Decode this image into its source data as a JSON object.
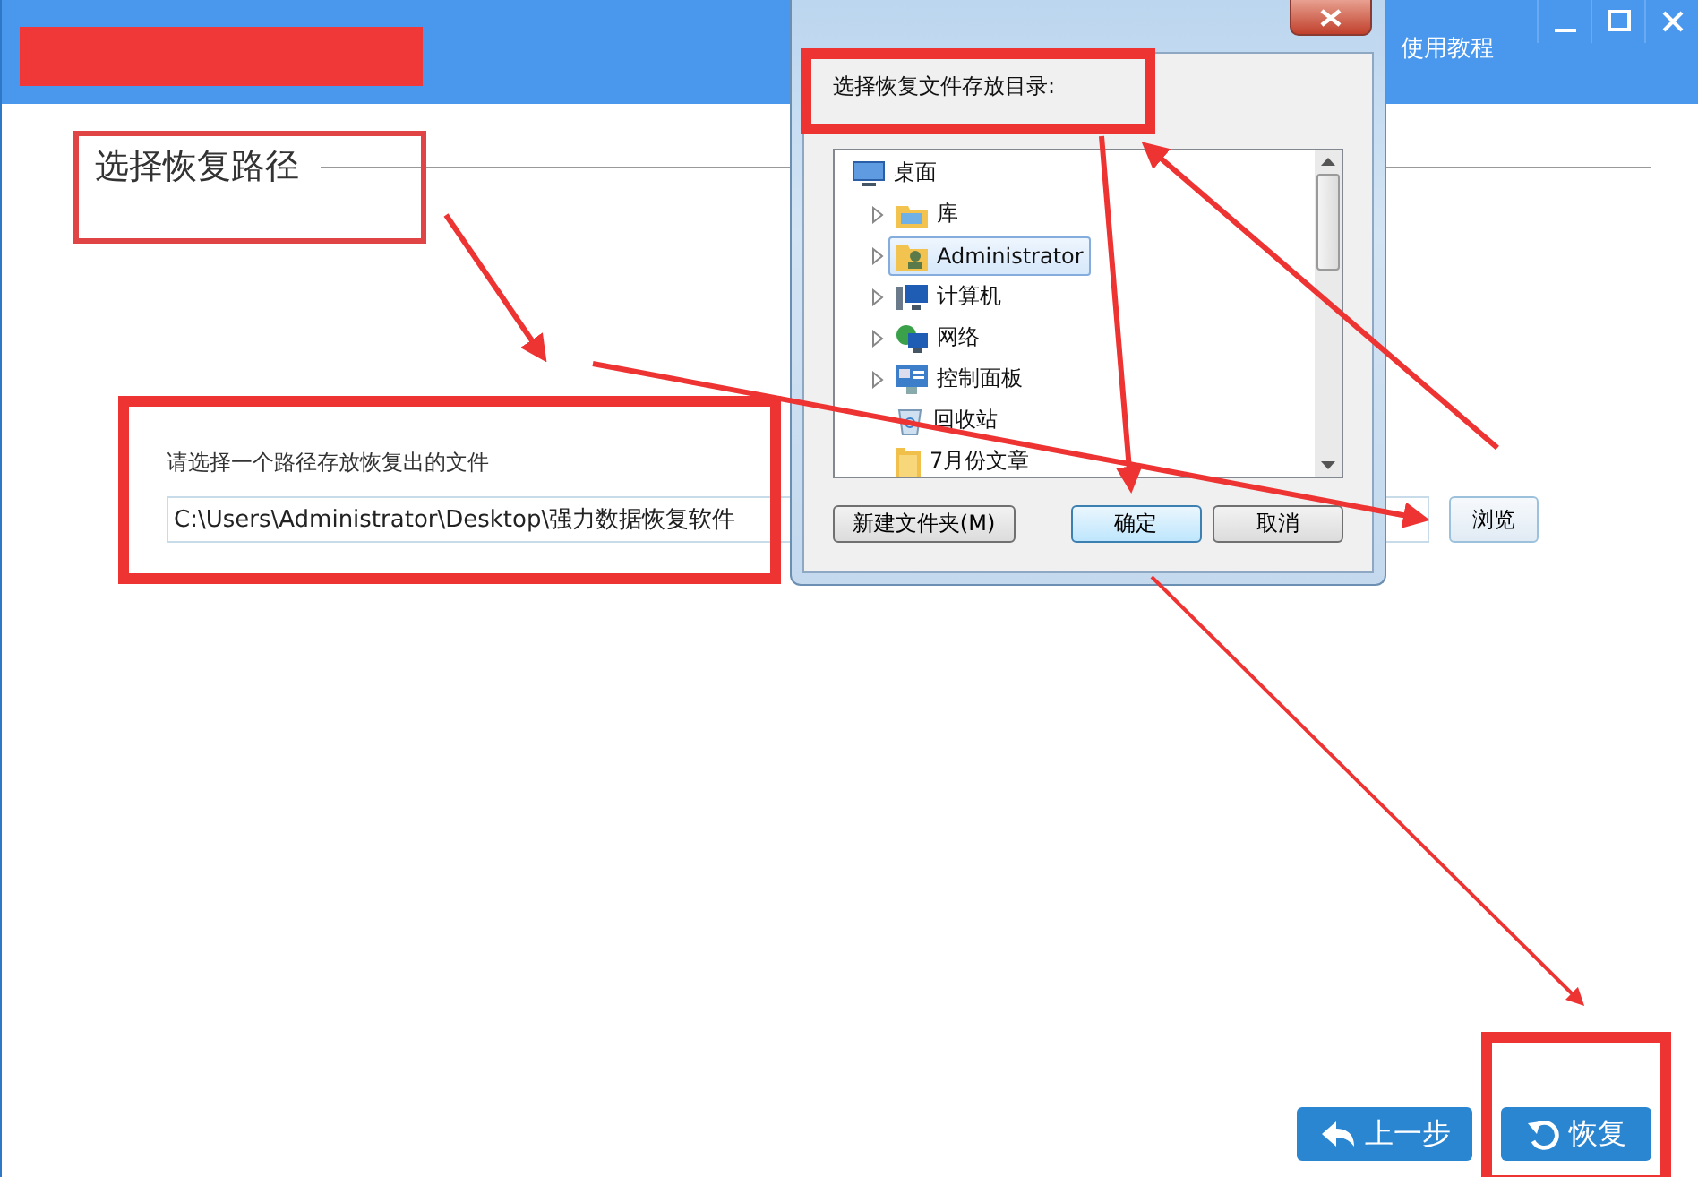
{
  "app": {
    "help_link": "使用教程",
    "heading": "选择恢复路径",
    "path_label": "请选择一个路径存放恢复出的文件",
    "path_value": "C:\\Users\\Administrator\\Desktop\\强力数据恢复软件",
    "browse_button": "浏览",
    "back_button": "上一步",
    "restore_button": "恢复"
  },
  "dialog": {
    "prompt": "选择恢复文件存放目录:",
    "tree": [
      {
        "label": "桌面",
        "kind": "desktop",
        "expandable": false,
        "selected": false,
        "children": [
          {
            "label": "库",
            "kind": "library",
            "expandable": true,
            "selected": false
          },
          {
            "label": "Administrator",
            "kind": "user",
            "expandable": true,
            "selected": true
          },
          {
            "label": "计算机",
            "kind": "computer",
            "expandable": true,
            "selected": false
          },
          {
            "label": "网络",
            "kind": "network",
            "expandable": true,
            "selected": false
          },
          {
            "label": "控制面板",
            "kind": "control-panel",
            "expandable": true,
            "selected": false
          },
          {
            "label": "回收站",
            "kind": "recycle-bin",
            "expandable": false,
            "selected": false
          },
          {
            "label": "7月份文章",
            "kind": "folder",
            "expandable": false,
            "selected": false
          }
        ]
      }
    ],
    "buttons": [
      {
        "label": "新建文件夹(M)",
        "kind": "normal"
      },
      {
        "label": "确定",
        "kind": "default"
      },
      {
        "label": "取消",
        "kind": "normal"
      }
    ]
  }
}
